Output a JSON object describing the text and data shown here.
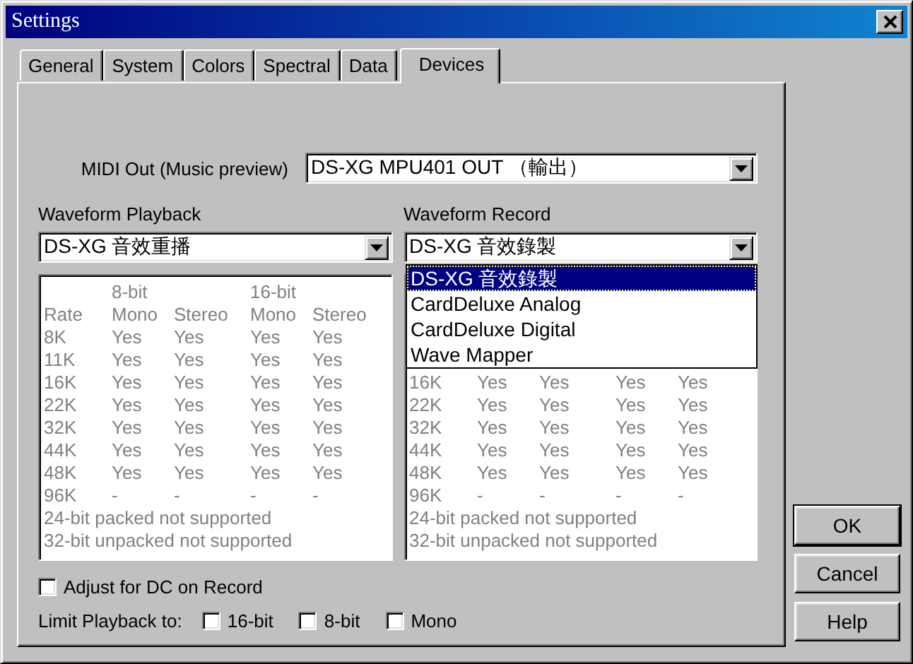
{
  "window": {
    "title": "Settings"
  },
  "tabs": [
    {
      "label": "General",
      "selected": false
    },
    {
      "label": "System",
      "selected": false
    },
    {
      "label": "Colors",
      "selected": false
    },
    {
      "label": "Spectral",
      "selected": false
    },
    {
      "label": "Data",
      "selected": false
    },
    {
      "label": "Devices",
      "selected": true
    }
  ],
  "midi_out": {
    "label": "MIDI Out (Music preview)",
    "value": "DS-XG MPU401 OUT （輸出）"
  },
  "playback": {
    "label": "Waveform Playback",
    "value": "DS-XG 音效重播",
    "table": {
      "disabled": true,
      "groups": [
        "8-bit",
        "16-bit"
      ],
      "columns": [
        "Rate",
        "Mono",
        "Stereo",
        "Mono",
        "Stereo"
      ],
      "rows": [
        [
          "8K",
          "Yes",
          "Yes",
          "Yes",
          "Yes"
        ],
        [
          "11K",
          "Yes",
          "Yes",
          "Yes",
          "Yes"
        ],
        [
          "16K",
          "Yes",
          "Yes",
          "Yes",
          "Yes"
        ],
        [
          "22K",
          "Yes",
          "Yes",
          "Yes",
          "Yes"
        ],
        [
          "32K",
          "Yes",
          "Yes",
          "Yes",
          "Yes"
        ],
        [
          "44K",
          "Yes",
          "Yes",
          "Yes",
          "Yes"
        ],
        [
          "48K",
          "Yes",
          "Yes",
          "Yes",
          "Yes"
        ],
        [
          "96K",
          "-",
          "-",
          "-",
          "-"
        ]
      ],
      "notes": [
        "24-bit packed not supported",
        "32-bit unpacked not supported"
      ]
    }
  },
  "record": {
    "label": "Waveform Record",
    "value": "DS-XG 音效錄製",
    "dropdown": {
      "items": [
        {
          "label": "DS-XG 音效錄製",
          "selected": true
        },
        {
          "label": "CardDeluxe Analog",
          "selected": false
        },
        {
          "label": "CardDeluxe Digital",
          "selected": false
        },
        {
          "label": "Wave Mapper",
          "selected": false
        }
      ]
    },
    "table": {
      "disabled": true,
      "rows": [
        [
          "16K",
          "Yes",
          "Yes",
          "Yes",
          "Yes"
        ],
        [
          "22K",
          "Yes",
          "Yes",
          "Yes",
          "Yes"
        ],
        [
          "32K",
          "Yes",
          "Yes",
          "Yes",
          "Yes"
        ],
        [
          "44K",
          "Yes",
          "Yes",
          "Yes",
          "Yes"
        ],
        [
          "48K",
          "Yes",
          "Yes",
          "Yes",
          "Yes"
        ],
        [
          "96K",
          "-",
          "-",
          "-",
          "-"
        ]
      ],
      "notes": [
        "24-bit packed not supported",
        "32-bit unpacked not supported"
      ]
    }
  },
  "adjust_dc": {
    "label": "Adjust for DC on Record",
    "checked": false
  },
  "limit_playback": {
    "label": "Limit Playback to:",
    "options": [
      {
        "label": "16-bit",
        "checked": false
      },
      {
        "label": "8-bit",
        "checked": false
      },
      {
        "label": "Mono",
        "checked": false
      }
    ]
  },
  "buttons": [
    {
      "label": "OK",
      "default": true
    },
    {
      "label": "Cancel",
      "default": false
    },
    {
      "label": "Help",
      "default": false
    }
  ]
}
